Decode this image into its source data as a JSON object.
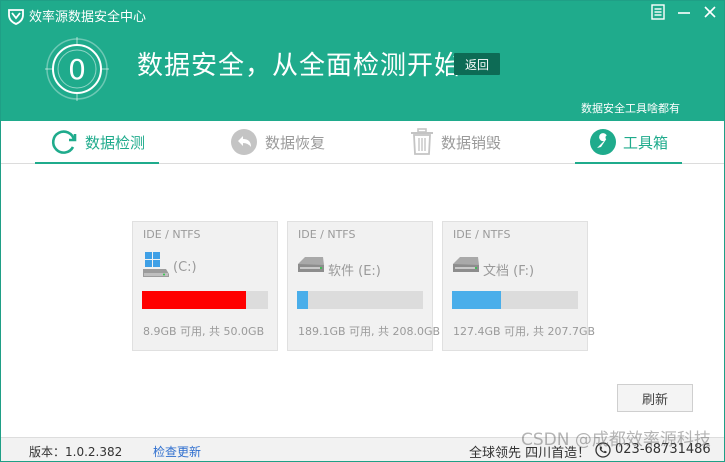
{
  "app": {
    "title": "效率源数据安全中心"
  },
  "header": {
    "score": "0",
    "headline": "数据安全，从全面检测开始",
    "back_label": "返回",
    "tools_link": "数据安全工具啥都有",
    "accent_color": "#1fab8c"
  },
  "tabs": [
    {
      "label": "数据检测",
      "icon": "refresh-circle-icon",
      "active": true
    },
    {
      "label": "数据恢复",
      "icon": "undo-arrow-icon",
      "active": false
    },
    {
      "label": "数据销毁",
      "icon": "trash-icon",
      "active": false
    },
    {
      "label": "工具箱",
      "icon": "wrench-icon",
      "active": true
    }
  ],
  "drives": [
    {
      "fs": "IDE / NTFS",
      "name": "(C:)",
      "usage": "8.9GB 可用, 共 50.0GB",
      "icon": "windows-drive-icon",
      "used_fraction": 0.822,
      "bar_color": "#ff0000"
    },
    {
      "fs": "IDE / NTFS",
      "name": "软件 (E:)",
      "usage": "189.1GB 可用, 共 208.0GB",
      "icon": "hard-drive-icon",
      "used_fraction": 0.091,
      "bar_color": "#4aaeea"
    },
    {
      "fs": "IDE / NTFS",
      "name": "文档 (F:)",
      "usage": "127.4GB 可用, 共 207.7GB",
      "icon": "hard-drive-icon",
      "used_fraction": 0.387,
      "bar_color": "#4aaeea"
    }
  ],
  "refresh_label": "刷新",
  "status": {
    "version": "版本：1.0.2.382",
    "update_label": "检查更新",
    "slogan": "全球领先 四川首造！",
    "phone": "023-68731486"
  },
  "watermark": "CSDN @成都效率源科技"
}
